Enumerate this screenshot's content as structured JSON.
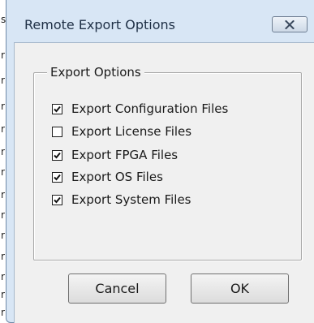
{
  "background_app": {
    "fragments": [
      "s",
      "r",
      "r",
      "r",
      "r",
      "r",
      "r",
      "r",
      "r",
      "r",
      "r",
      "r",
      "r",
      "r"
    ]
  },
  "dialog": {
    "title": "Remote Export Options",
    "close_icon": "close-x-icon",
    "group_title": "Export Options",
    "options": [
      {
        "label": "Export Configuration Files",
        "checked": true
      },
      {
        "label": "Export License Files",
        "checked": false
      },
      {
        "label": "Export FPGA Files",
        "checked": true
      },
      {
        "label": "Export OS Files",
        "checked": true
      },
      {
        "label": "Export System Files",
        "checked": true
      }
    ],
    "buttons": {
      "cancel": "Cancel",
      "ok": "OK"
    }
  },
  "colors": {
    "frame": "#d8e6f5",
    "client": "#f0f0f0",
    "title_text": "#1e2f45"
  }
}
